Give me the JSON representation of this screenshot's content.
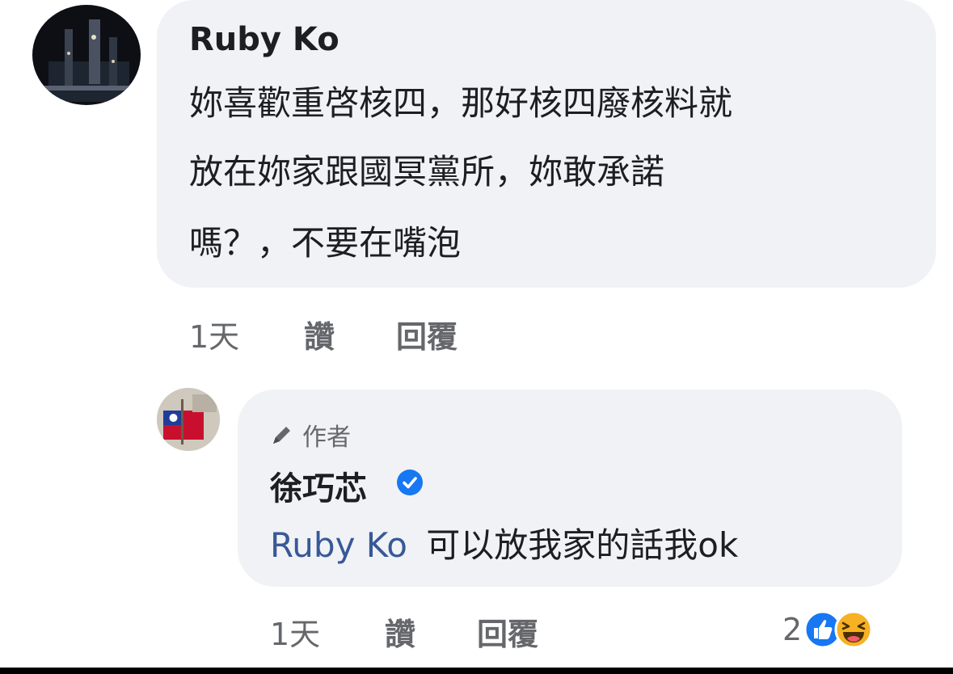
{
  "comment": {
    "author": "Ruby Ko",
    "lines": [
      "妳喜歡重啓核四，那好核四廢核料就",
      "放在妳家跟國冥黨所，妳敢承諾",
      "嗎？，不要在嘴泡"
    ],
    "time": "1天",
    "like": "讚",
    "reply": "回覆"
  },
  "reply": {
    "badge": "作者",
    "author": "徐巧芯",
    "mention": "Ruby Ko",
    "text": "可以放我家的話我ok",
    "time": "1天",
    "like": "讚",
    "reply": "回覆",
    "reaction_count": "2",
    "reaction_icons": [
      "like-icon",
      "haha-icon"
    ]
  },
  "colors": {
    "bubble": "#f0f2f5",
    "text": "#1c1e21",
    "muted": "#65676b",
    "mention": "#385898",
    "verified": "#1877f2"
  }
}
